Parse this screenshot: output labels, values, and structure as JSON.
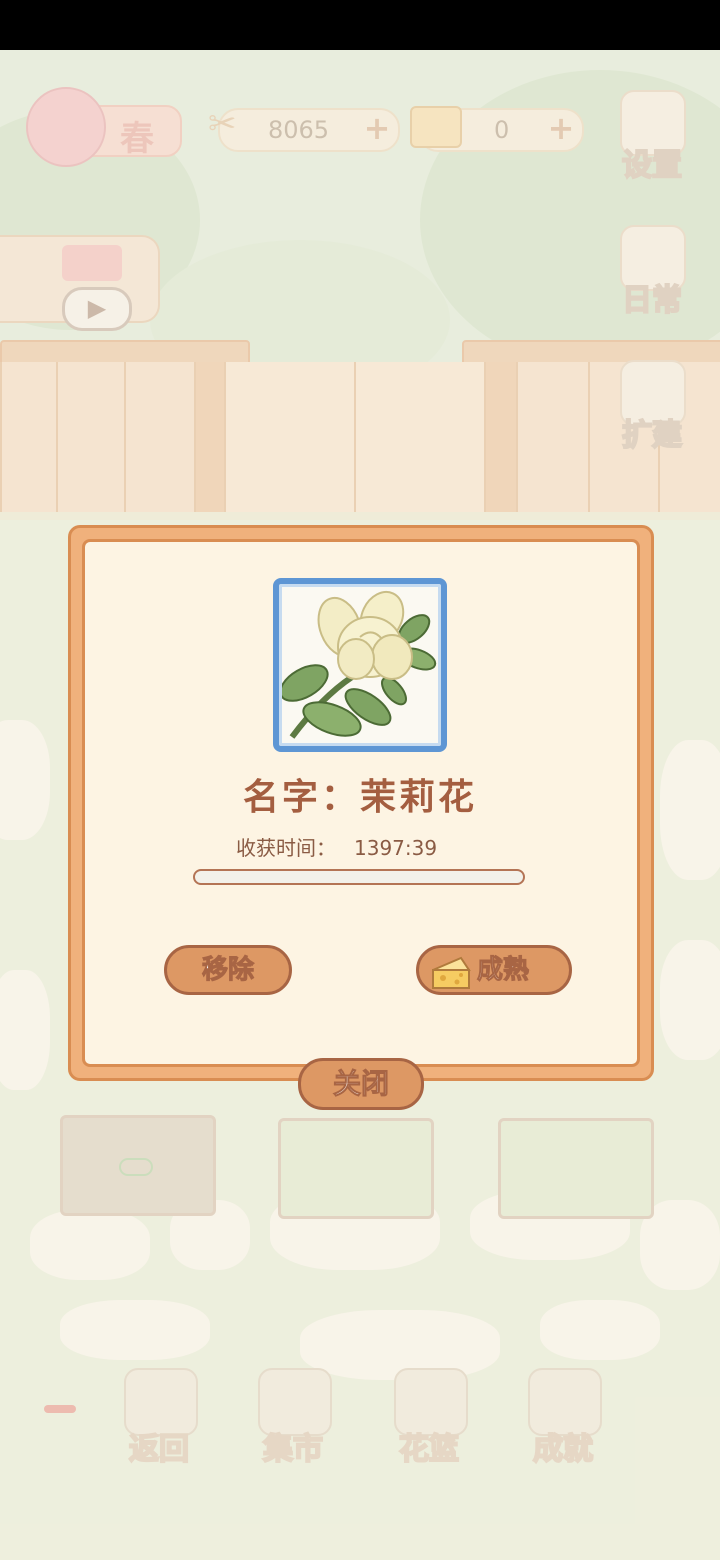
{
  "hud": {
    "season_label": "春",
    "fish_bones": "8065",
    "cheese": "0",
    "plus_symbol": "+"
  },
  "side_buttons": {
    "settings": "设置",
    "daily": "日常",
    "expand": "扩建"
  },
  "dialog": {
    "name_line": "名字：茉莉花",
    "harvest_label": "收获时间：",
    "harvest_time": "1397:39",
    "growth_progress_percent": 0,
    "remove_label": "移除",
    "ripen_label": "成熟",
    "close_label": "关闭"
  },
  "bottom_nav": {
    "back": "返回",
    "market": "集市",
    "basket": "花篮",
    "achievements": "成就"
  },
  "colors": {
    "accent_orange": "#dd9864",
    "frame_blue": "#5e96d4",
    "name_brown": "#a45e40"
  }
}
